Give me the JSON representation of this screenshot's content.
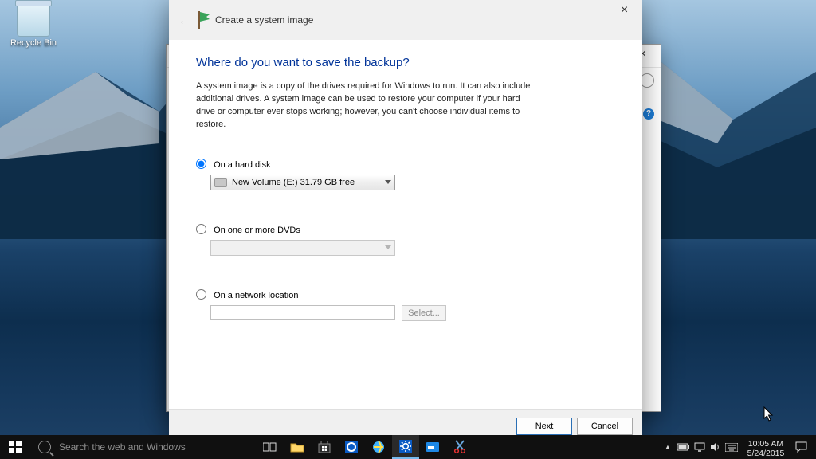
{
  "desktop": {
    "recycle_label": "Recycle Bin"
  },
  "bgwin": {
    "help_char": "?"
  },
  "wizard": {
    "title": "Create a system image",
    "close_char": "×",
    "back_char": "←",
    "heading": "Where do you want to save the backup?",
    "description": "A system image is a copy of the drives required for Windows to run. It can also include additional drives. A system image can be used to restore your computer if your hard drive or computer ever stops working; however, you can't choose individual items to restore.",
    "options": {
      "hdd": {
        "label": "On a hard disk",
        "selected_value": "New Volume (E:)  31.79 GB free",
        "checked": true
      },
      "dvd": {
        "label": "On one or more DVDs",
        "selected_value": "",
        "checked": false
      },
      "net": {
        "label": "On a network location",
        "input_value": "",
        "checked": false,
        "select_label": "Select..."
      }
    },
    "footer": {
      "next": "Next",
      "cancel": "Cancel"
    }
  },
  "taskbar": {
    "search_placeholder": "Search the web and Windows",
    "time": "10:05 AM",
    "date": "5/24/2015"
  }
}
